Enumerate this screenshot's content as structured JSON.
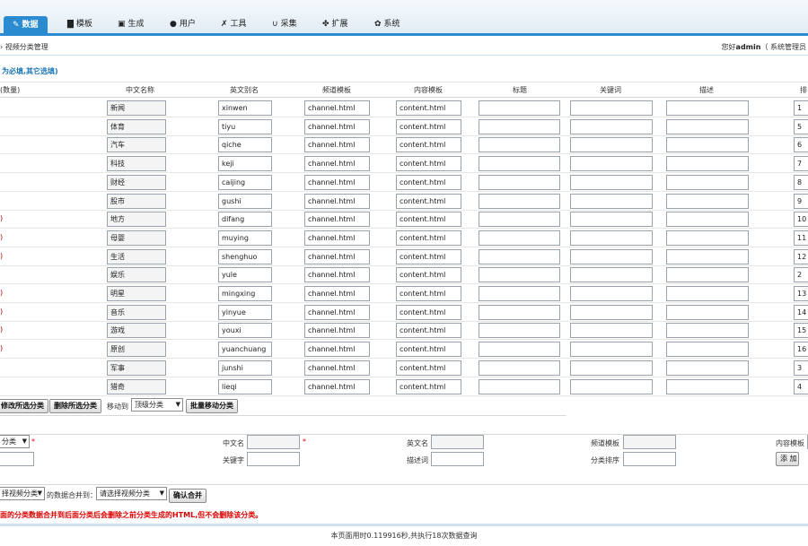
{
  "nav": {
    "tabs": [
      {
        "label": "数据",
        "icon": "edit-icon",
        "glyph": "✎",
        "active": true
      },
      {
        "label": "模板",
        "icon": "file-icon",
        "glyph": "▇"
      },
      {
        "label": "生成",
        "icon": "note-icon",
        "glyph": "▣"
      },
      {
        "label": "用户",
        "icon": "user-icon",
        "glyph": "●"
      },
      {
        "label": "工具",
        "icon": "wrench-icon",
        "glyph": "✗"
      },
      {
        "label": "采集",
        "icon": "magnet-icon",
        "glyph": "∪"
      },
      {
        "label": "扩展",
        "icon": "puzzle-icon",
        "glyph": "✤"
      },
      {
        "label": "系统",
        "icon": "gear-icon",
        "glyph": "✿"
      }
    ]
  },
  "breadcrumb": "› 视频分类管理",
  "welcome": {
    "prefix": "您好",
    "user": "admin",
    "suffix": "（ 系统管理员"
  },
  "note": "为必填,其它选填)",
  "headers": {
    "count": "(数量)",
    "cname": "中文名称",
    "ename": "英文别名",
    "channel": "频道模板",
    "content": "内容模板",
    "title": "标题",
    "keywords": "关键词",
    "desc": "描述",
    "sort": "排"
  },
  "rows": [
    {
      "count": "",
      "cn": "新闻",
      "en": "xinwen",
      "ch": "channel.html",
      "ct": "content.html",
      "sort": "1"
    },
    {
      "count": "",
      "cn": "体育",
      "en": "tiyu",
      "ch": "channel.html",
      "ct": "content.html",
      "sort": "5"
    },
    {
      "count": "",
      "cn": "汽车",
      "en": "qiche",
      "ch": "channel.html",
      "ct": "content.html",
      "sort": "6"
    },
    {
      "count": "",
      "cn": "科技",
      "en": "keji",
      "ch": "channel.html",
      "ct": "content.html",
      "sort": "7"
    },
    {
      "count": "",
      "cn": "财经",
      "en": "caijing",
      "ch": "channel.html",
      "ct": "content.html",
      "sort": "8"
    },
    {
      "count": "",
      "cn": "股市",
      "en": "gushi",
      "ch": "channel.html",
      "ct": "content.html",
      "sort": "9"
    },
    {
      "count": ")",
      "cn": "地方",
      "en": "difang",
      "ch": "channel.html",
      "ct": "content.html",
      "sort": "10"
    },
    {
      "count": ")",
      "cn": "母婴",
      "en": "muying",
      "ch": "channel.html",
      "ct": "content.html",
      "sort": "11"
    },
    {
      "count": ")",
      "cn": "生活",
      "en": "shenghuo",
      "ch": "channel.html",
      "ct": "content.html",
      "sort": "12"
    },
    {
      "count": "",
      "cn": "娱乐",
      "en": "yule",
      "ch": "channel.html",
      "ct": "content.html",
      "sort": "2"
    },
    {
      "count": ")",
      "cn": "明星",
      "en": "mingxing",
      "ch": "channel.html",
      "ct": "content.html",
      "sort": "13"
    },
    {
      "count": ")",
      "cn": "音乐",
      "en": "yinyue",
      "ch": "channel.html",
      "ct": "content.html",
      "sort": "14"
    },
    {
      "count": ")",
      "cn": "游戏",
      "en": "youxi",
      "ch": "channel.html",
      "ct": "content.html",
      "sort": "15"
    },
    {
      "count": ")",
      "cn": "原创",
      "en": "yuanchuang",
      "ch": "channel.html",
      "ct": "content.html",
      "sort": "16"
    },
    {
      "count": "",
      "cn": "军事",
      "en": "junshi",
      "ch": "channel.html",
      "ct": "content.html",
      "sort": "3"
    },
    {
      "count": "",
      "cn": "猎奇",
      "en": "lieqi",
      "ch": "channel.html",
      "ct": "content.html",
      "sort": "4"
    }
  ],
  "batch": {
    "modify": "修改所选分类",
    "delete": "删除所选分类",
    "move_to": "移动到",
    "move_select": "顶级分类",
    "move_button": "批量移动分类"
  },
  "add_form": {
    "parent_select": "分类",
    "cname": "中文名",
    "ename": "英文名",
    "channel": "频道模板",
    "content": "内容模板",
    "keywords": "关键字",
    "desc": "描述词",
    "sort": "分类排序",
    "add_button": "添 加"
  },
  "merge": {
    "source_select": "择视频分类",
    "text": "的数据合并到：",
    "target_select": "请选择视频分类",
    "button": "确认合并",
    "warning": "面的分类数据合并到后面分类后会删除之前分类生成的HTML,但不会删除该分类。"
  },
  "footer": "本页面用时0.119916秒,共执行18次数据查询"
}
